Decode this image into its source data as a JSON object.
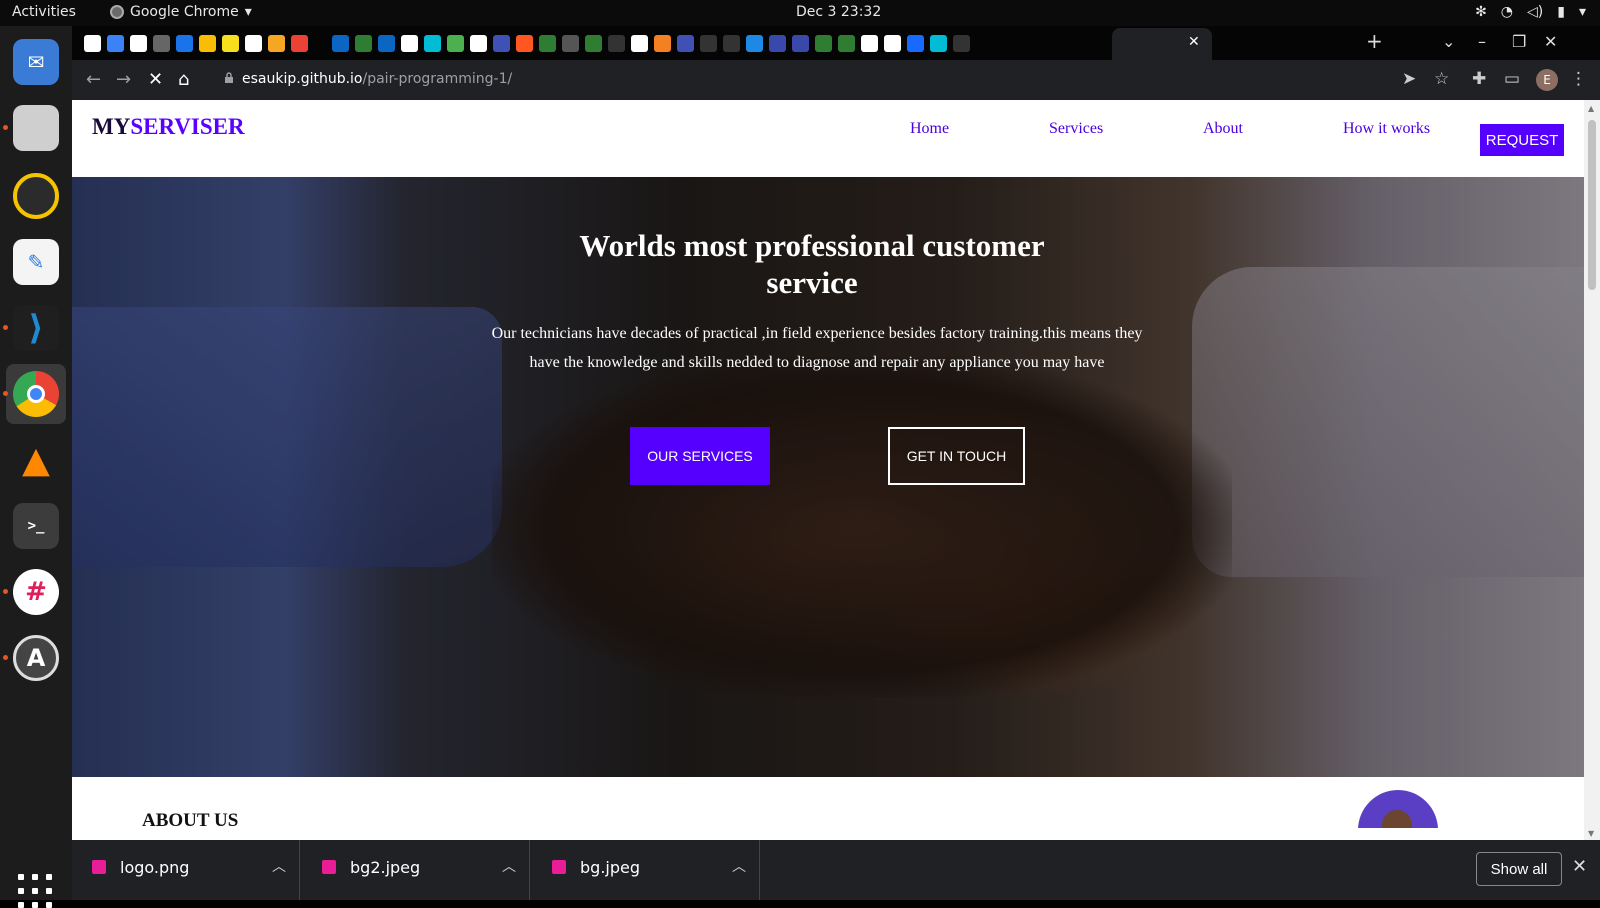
{
  "system": {
    "activities_label": "Activities",
    "app_menu_label": "Google Chrome",
    "app_menu_arrow": "▾",
    "clock": "Dec 3  23:32",
    "tray_icons": [
      "network-icon",
      "wifi-icon",
      "volume-icon",
      "battery-icon",
      "power-menu-icon"
    ]
  },
  "dock": {
    "apps": [
      {
        "name": "thunderbird",
        "color": "#3a7bd5"
      },
      {
        "name": "files",
        "color": "#c9c9c9"
      },
      {
        "name": "rhythmbox",
        "color": "#f5c400"
      },
      {
        "name": "text-editor",
        "color": "#2f7ad8"
      },
      {
        "name": "vscode",
        "color": "#1f8ad2"
      },
      {
        "name": "chrome",
        "color": "#34a853"
      },
      {
        "name": "vlc",
        "color": "#ff8800"
      },
      {
        "name": "terminal",
        "color": "#3c3c3c"
      },
      {
        "name": "slack",
        "color": "#ffffff"
      },
      {
        "name": "software-updater",
        "color": "#555555"
      }
    ]
  },
  "browser": {
    "url_host": "esaukip.github.io",
    "url_path": "/pair-programming-1/",
    "tab_close": "✕",
    "new_tab": "+",
    "profile_initial": "E"
  },
  "site": {
    "brand_prefix": "MY",
    "brand_accent": "SERVISER",
    "nav": [
      "Home",
      "Services",
      "About",
      "How it works"
    ],
    "request_button": "REQUEST",
    "hero_title": "Worlds most professional customer service",
    "hero_text": "Our technicians have decades of practical ,in field experience besides factory training.this means they have the knowledge and skills nedded to diagnose and repair any appliance you may have",
    "primary_button": "OUR SERVICES",
    "secondary_button": "GET IN TOUCH",
    "about_heading": "ABOUT US",
    "colors": {
      "accent": "#5500ff",
      "link": "#4b00e0"
    }
  },
  "downloads": {
    "items": [
      "logo.png",
      "bg2.jpeg",
      "bg.jpeg"
    ],
    "show_all": "Show all",
    "close": "✕"
  }
}
